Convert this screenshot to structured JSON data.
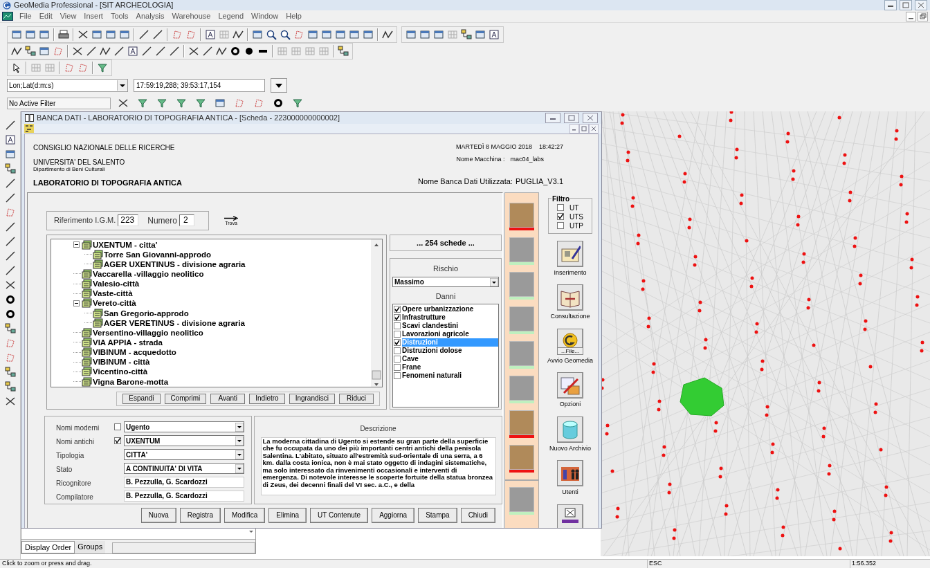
{
  "app": {
    "title": "GeoMedia Professional - [SIT ARCHEOLOGIA]"
  },
  "menu": [
    "File",
    "Edit",
    "View",
    "Insert",
    "Tools",
    "Analysis",
    "Warehouse",
    "Legend",
    "Window",
    "Help"
  ],
  "coordinates": {
    "system": "Lon;Lat(d:m:s)",
    "value": "17:59:19,288; 39:53:17,154"
  },
  "filter": {
    "value": "No Active Filter"
  },
  "dialog": {
    "title": "BANCA DATI - LABORATORIO DI TOPOGRAFIA ANTICA - [Scheda - 223000000000002]",
    "header_left": [
      "CONSIGLIO NAZIONALE DELLE RICERCHE",
      "UNIVERSITA' DEL SALENTO",
      "Dipartimento di Beni Culturali",
      "LABORATORIO DI TOPOGRAFIA ANTICA"
    ],
    "date": "MARTEDÌ 8 MAGGIO 2018",
    "time": "18:42:27",
    "machine_label": "Nome Macchina :",
    "machine": "mac04_labs",
    "db_label": "Nome Banca Dati Utilizzata:",
    "db": "PUGLIA_V3.1",
    "riferimento": {
      "label": "Riferimento I.G.M.",
      "value": "223",
      "numero_label": "Numero",
      "numero": "2",
      "find": "Trova"
    },
    "tree": [
      {
        "label": "UXENTUM - citta'",
        "expanded": true,
        "children": [
          {
            "label": "Torre San Giovanni-approdo"
          },
          {
            "label": "AGER UXENTINUS - divisione agraria"
          }
        ]
      },
      {
        "label": "Vaccarella -villaggio neolitico"
      },
      {
        "label": "Valesio-città"
      },
      {
        "label": "Vaste-città"
      },
      {
        "label": "Vereto-città",
        "expanded": true,
        "children": [
          {
            "label": "San Gregorio-approdo"
          },
          {
            "label": "AGER VERETINUS - divisione agraria"
          }
        ]
      },
      {
        "label": "Versentino-villaggio neolitico"
      },
      {
        "label": "VIA APPIA - strada"
      },
      {
        "label": "VIBINUM - acquedotto"
      },
      {
        "label": "VIBINUM - città"
      },
      {
        "label": "Vicentino-città"
      },
      {
        "label": "Vigna Barone-motta"
      }
    ],
    "tree_buttons": [
      "Espandi",
      "Comprimi",
      "Avanti",
      "Indietro",
      "Ingrandisci",
      "Riduci"
    ],
    "count": "... 254  schede ...",
    "rischio": {
      "label": "Rischio",
      "value": "Massimo"
    },
    "danni": {
      "label": "Danni",
      "items": [
        {
          "label": "Opere urbanizzazione",
          "checked": true,
          "selected": false
        },
        {
          "label": "Infrastrutture",
          "checked": true,
          "selected": false
        },
        {
          "label": "Scavi clandestini",
          "checked": false,
          "selected": false
        },
        {
          "label": "Lavorazioni agricole",
          "checked": false,
          "selected": false
        },
        {
          "label": "Distruzioni",
          "checked": true,
          "selected": true
        },
        {
          "label": "Distruzioni dolose",
          "checked": false,
          "selected": false
        },
        {
          "label": "Cave",
          "checked": false,
          "selected": false
        },
        {
          "label": "Frane",
          "checked": false,
          "selected": false
        },
        {
          "label": "Fenomeni naturali",
          "checked": false,
          "selected": false
        }
      ]
    },
    "fields": [
      {
        "label": "Nomi moderni",
        "kind": "checkcombo",
        "checked": false,
        "value": "Ugento"
      },
      {
        "label": "Nomi antichi",
        "kind": "checkcombo",
        "checked": true,
        "value": "UXENTUM"
      },
      {
        "label": "Tipologia",
        "kind": "combo",
        "value": "CITTA'"
      },
      {
        "label": "Stato",
        "kind": "combo",
        "value": "A CONTINUITA' DI VITA"
      },
      {
        "label": "Ricognitore",
        "kind": "text",
        "value": "B. Pezzulla, G. Scardozzi"
      },
      {
        "label": "Compilatore",
        "kind": "text",
        "value": "B. Pezzulla, G. Scardozzi"
      }
    ],
    "description": {
      "label": "Descrizione",
      "text": "La moderna cittadina di Ugento si estende su gran parte della superficie che fu occupata da uno dei più importanti centri antichi della penisola Salentina. L'abitato, situato all'estremità sud-orientale di una serra, a 6 km. dalla costa ionica, non è mai stato oggetto di indagini sistematiche, ma solo interessato da rinvenimenti occasionali e interventi di emergenza. Di notevole interesse le scoperte fortuite della statua bronzea di Zeus, dei decenni finali del VI sec. a.C., e della"
    },
    "actions": [
      "Nuova",
      "Registra",
      "Modifica",
      "Elimina",
      "UT Contenute",
      "Aggiorna",
      "Stampa",
      "Chiudi"
    ],
    "strip": [
      {
        "active": true,
        "color": "#ee1111"
      },
      {
        "active": false,
        "color": "#bff0bf"
      },
      {
        "active": false,
        "color": "#bff0bf"
      },
      {
        "active": false,
        "color": "#bff0bf"
      },
      {
        "active": false,
        "color": "#bff0bf"
      },
      {
        "active": false,
        "color": "#bff0bf"
      },
      {
        "active": true,
        "color": "#ee1111"
      },
      {
        "active": true,
        "color": "#ee1111"
      }
    ],
    "strip_bottom": {
      "active": false,
      "color": "#bff0bf"
    },
    "filtro": {
      "label": "Filtro",
      "options": [
        {
          "label": "UT",
          "checked": false
        },
        {
          "label": "UTS",
          "checked": true
        },
        {
          "label": "UTP",
          "checked": false
        }
      ]
    },
    "side_buttons": [
      {
        "kind": "book",
        "label": "Inserimento"
      },
      {
        "kind": "openbook",
        "label": "Consultazione"
      },
      {
        "kind": "file",
        "caption": "...File...",
        "label": "Avvio Geomedia"
      },
      {
        "kind": "tools",
        "label": "Opzioni"
      },
      {
        "kind": "database",
        "label": "Nuovo Archivio"
      },
      {
        "kind": "users",
        "label": "Utenti"
      },
      {
        "kind": "window"
      }
    ]
  },
  "legend": {
    "tabs": [
      {
        "label": "Display Order",
        "selected": true
      },
      {
        "label": "Groups",
        "selected": false
      }
    ]
  },
  "status_bar": {
    "message": "Click to zoom or press and drag.",
    "key": "ESC",
    "scale": "1:56.352"
  }
}
